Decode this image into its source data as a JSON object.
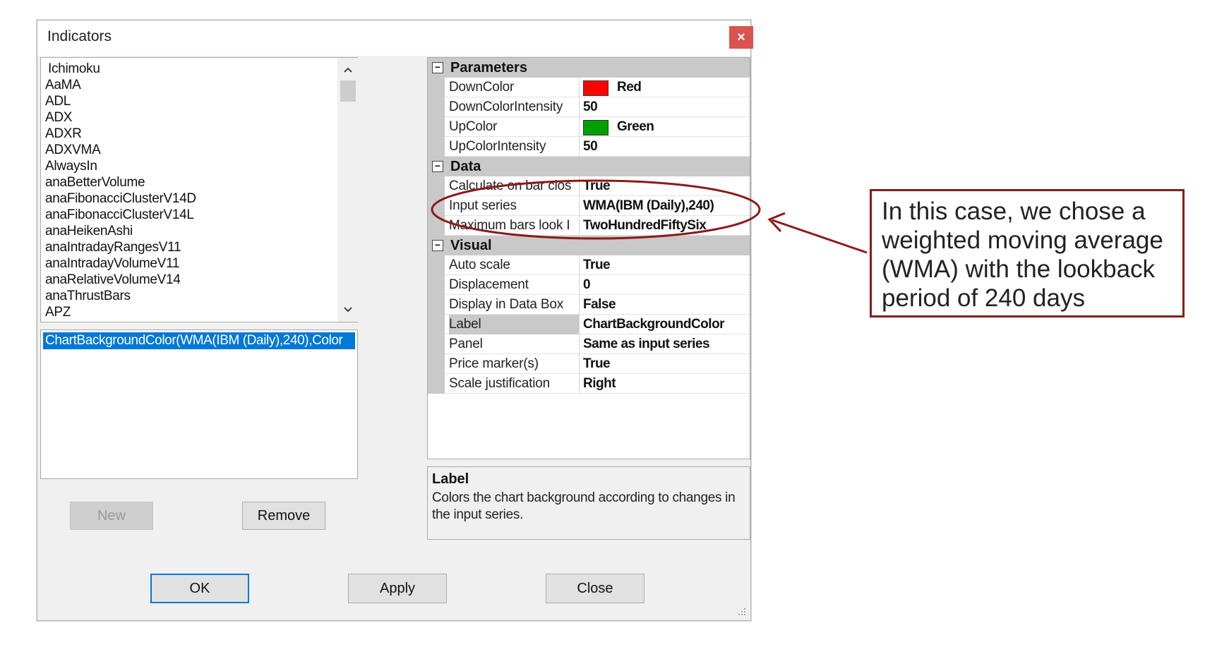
{
  "window": {
    "title": "Indicators",
    "close_glyph": "×"
  },
  "indicator_list": {
    "items": [
      "Ichimoku",
      "AaMA",
      "ADL",
      "ADX",
      "ADXR",
      "ADXVMA",
      "AlwaysIn",
      "anaBetterVolume",
      "anaFibonacciClusterV14D",
      "anaFibonacciClusterV14L",
      "anaHeikenAshi",
      "anaIntradayRangesV11",
      "anaIntradayVolumeV11",
      "anaRelativeVolumeV14",
      "anaThrustBars",
      "APZ"
    ],
    "scroll_up": "^",
    "scroll_down": "v"
  },
  "configured": {
    "selected": "ChartBackgroundColor(WMA(IBM (Daily),240),Color"
  },
  "buttons": {
    "new": "New",
    "remove": "Remove",
    "ok": "OK",
    "apply": "Apply",
    "close": "Close"
  },
  "grid": {
    "toggle_glyph": "−",
    "categories": {
      "parameters": "Parameters",
      "data": "Data",
      "visual": "Visual"
    },
    "parameters": [
      {
        "name": "DownColor",
        "value": "Red",
        "swatch": "#ff0000"
      },
      {
        "name": "DownColorIntensity",
        "value": "50"
      },
      {
        "name": "UpColor",
        "value": "Green",
        "swatch": "#00a000"
      },
      {
        "name": "UpColorIntensity",
        "value": "50"
      }
    ],
    "data": [
      {
        "name": "Calculate on bar clos",
        "value": "True"
      },
      {
        "name": "Input series",
        "value": "WMA(IBM (Daily),240)"
      },
      {
        "name": "Maximum bars look I",
        "value": "TwoHundredFiftySix"
      }
    ],
    "visual": [
      {
        "name": "Auto scale",
        "value": "True"
      },
      {
        "name": "Displacement",
        "value": "0"
      },
      {
        "name": "Display in Data Box",
        "value": "False"
      },
      {
        "name": "Label",
        "value": "ChartBackgroundColor"
      },
      {
        "name": "Panel",
        "value": "Same as input series"
      },
      {
        "name": "Price marker(s)",
        "value": "True"
      },
      {
        "name": "Scale justification",
        "value": "Right"
      }
    ]
  },
  "description": {
    "title": "Label",
    "text": "Colors the chart background according to changes in the input series."
  },
  "callout": {
    "text": "In this case, we chose a weighted moving average (WMA) with the lookback period of 240 days",
    "color": "#8b1a1a"
  }
}
